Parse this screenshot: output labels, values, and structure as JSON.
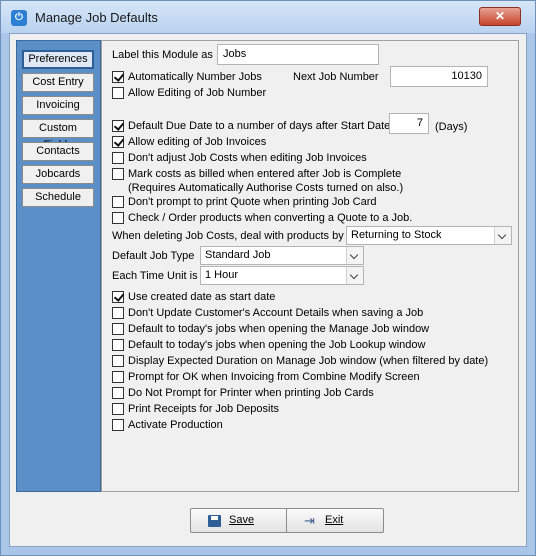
{
  "window": {
    "title": "Manage Job Defaults",
    "close_label": "✕"
  },
  "side_tabs": [
    {
      "label": "Preferences",
      "active": true
    },
    {
      "label": "Cost Entry"
    },
    {
      "label": "Invoicing"
    },
    {
      "label": "Custom Fields"
    },
    {
      "label": "Contacts"
    },
    {
      "label": "Jobcards"
    },
    {
      "label": "Schedule"
    }
  ],
  "module_label": {
    "label": "Label this Module as",
    "value": "Jobs"
  },
  "next_job": {
    "label": "Next Job Number",
    "value": "10130"
  },
  "due_days": {
    "value": "7",
    "unit": "(Days)"
  },
  "checkboxes": [
    {
      "label": "Automatically Number Jobs",
      "checked": true
    },
    {
      "label": "Allow Editing of Job Number",
      "checked": false
    },
    {
      "label": "Default Due Date to a number of days after Start Date",
      "checked": true
    },
    {
      "label": "Allow editing of Job Invoices",
      "checked": true
    },
    {
      "label": "Don't adjust Job Costs when editing Job Invoices",
      "checked": false
    },
    {
      "label": "Mark costs as billed when entered after Job is Complete",
      "sub": "(Requires Automatically Authorise Costs turned on also.)",
      "checked": false
    },
    {
      "label": "Don't prompt to print Quote when printing Job Card",
      "checked": false
    },
    {
      "label": "Check / Order products when converting a Quote to a Job.",
      "checked": false
    },
    {
      "label": "Use created date as start date",
      "checked": true
    },
    {
      "label": "Don't Update Customer's Account Details when saving a Job",
      "checked": false
    },
    {
      "label": "Default to today's jobs when opening the Manage Job window",
      "checked": false
    },
    {
      "label": "Default to today's jobs when opening the Job Lookup window",
      "checked": false
    },
    {
      "label": "Display Expected Duration on Manage Job window (when filtered by date)",
      "checked": false
    },
    {
      "label": "Prompt for OK when Invoicing from Combine Modify Screen",
      "checked": false
    },
    {
      "label": "Do Not Prompt for Printer when printing Job Cards",
      "checked": false
    },
    {
      "label": "Print Receipts for Job Deposits",
      "checked": false
    },
    {
      "label": "Activate Production",
      "checked": false
    }
  ],
  "deleting_costs": {
    "label": "When deleting Job Costs, deal with products by",
    "value": "Returning to Stock"
  },
  "job_type": {
    "label": "Default Job Type",
    "value": "Standard Job"
  },
  "time_unit": {
    "label": "Each Time Unit is",
    "value": "1 Hour"
  },
  "buttons": {
    "save": "Save",
    "exit": "Exit"
  },
  "icons": {
    "window": "app-power-icon",
    "save": "floppy-disk-icon",
    "exit": "exit-door-icon"
  }
}
